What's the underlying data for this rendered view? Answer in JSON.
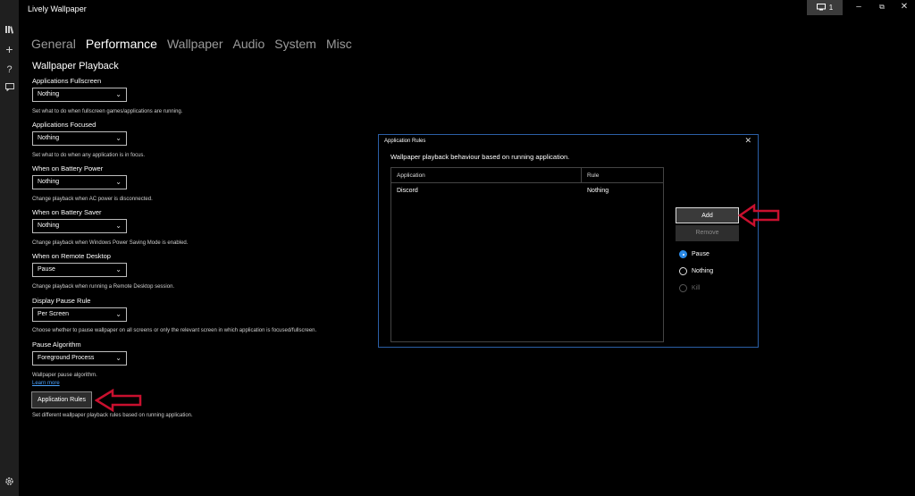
{
  "app": {
    "title": "Lively Wallpaper"
  },
  "titlebar": {
    "monitor_count": "1",
    "monitor_icon": "monitor-icon"
  },
  "sidebar": {
    "icons": [
      "library-icon",
      "add-icon",
      "help-icon",
      "feedback-icon",
      "settings-icon"
    ]
  },
  "tabs": [
    "General",
    "Performance",
    "Wallpaper",
    "Audio",
    "System",
    "Misc"
  ],
  "active_tab": "Performance",
  "section_title": "Wallpaper Playback",
  "settings": [
    {
      "label": "Applications Fullscreen",
      "value": "Nothing",
      "help": "Set what to do when fullscreen games/applications are running."
    },
    {
      "label": "Applications Focused",
      "value": "Nothing",
      "help": "Set what to do when any application is in focus."
    },
    {
      "label": "When on Battery Power",
      "value": "Nothing",
      "help": "Change playback when AC power is disconnected."
    },
    {
      "label": "When on Battery Saver",
      "value": "Nothing",
      "help": "Change playback when Windows Power Saving Mode is enabled."
    },
    {
      "label": "When on Remote Desktop",
      "value": "Pause",
      "help": "Change playback when running a Remote Desktop session."
    },
    {
      "label": "Display Pause Rule",
      "value": "Per Screen",
      "help": "Choose whether to pause wallpaper on all screens or only the relevant screen in which application is focused/fullscreen."
    },
    {
      "label": "Pause Algorithm",
      "value": "Foreground Process",
      "help": "Wallpaper pause algorithm."
    }
  ],
  "learn_more": "Learn more",
  "app_rules": {
    "button": "Application Rules",
    "help": "Set different wallpaper playback rules based on running application."
  },
  "dialog": {
    "title": "Application Rules",
    "description": "Wallpaper playback behaviour based on running application.",
    "columns": [
      "Application",
      "Rule"
    ],
    "rows": [
      {
        "application": "Discord",
        "rule": "Nothing"
      }
    ],
    "add_button": "Add",
    "remove_button": "Remove",
    "options": [
      {
        "label": "Pause",
        "selected": true,
        "enabled": true
      },
      {
        "label": "Nothing",
        "selected": false,
        "enabled": true
      },
      {
        "label": "Kill",
        "selected": false,
        "enabled": false
      }
    ]
  },
  "colors": {
    "accent": "#2b8ae6",
    "dialog_border": "#2b5fa6",
    "arrow": "#c8102e",
    "background": "#000000",
    "sidebar": "#1f1f1f"
  }
}
